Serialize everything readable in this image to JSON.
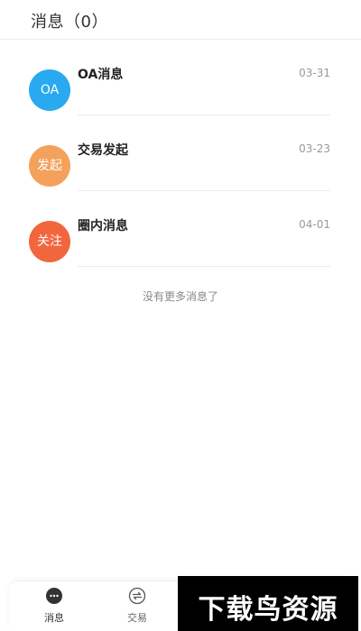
{
  "header": {
    "title": "消息（0）"
  },
  "messages": [
    {
      "avatar_text": "OA",
      "avatar_color": "#29a9ef",
      "title": "OA消息",
      "date": "03-31"
    },
    {
      "avatar_text": "发起",
      "avatar_color": "#f4a25b",
      "title": "交易发起",
      "date": "03-23"
    },
    {
      "avatar_text": "关注",
      "avatar_color": "#f2663e",
      "title": "圈内消息",
      "date": "04-01"
    }
  ],
  "list_footer": "没有更多消息了",
  "tabbar": {
    "tabs": [
      {
        "label": "消息",
        "icon": "chat-bubble-icon",
        "active": true
      },
      {
        "label": "交易",
        "icon": "exchange-icon",
        "active": false
      }
    ]
  },
  "watermark": {
    "text": "下载鸟资源"
  }
}
